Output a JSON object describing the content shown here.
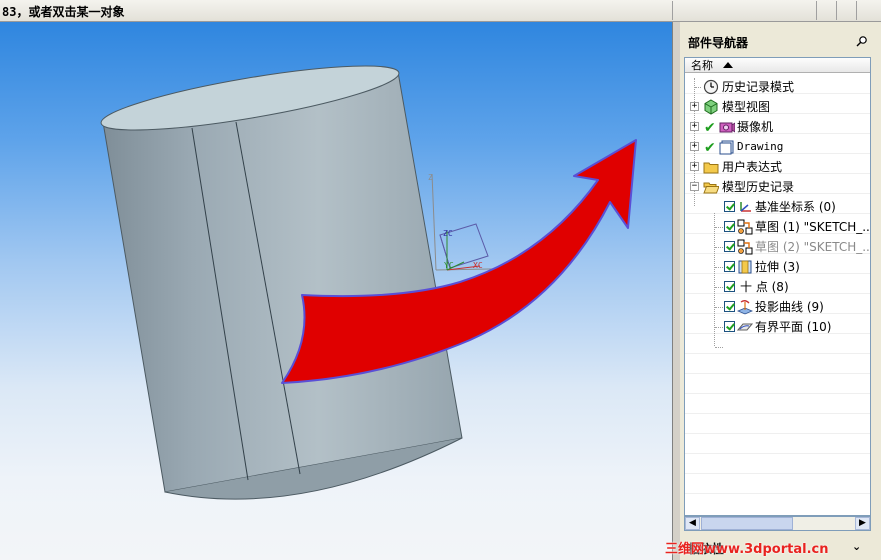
{
  "status_bar": {
    "message": "83，或者双击某一对象"
  },
  "navigator": {
    "title": "部件导航器",
    "column_header": "名称",
    "pin_icon": "pin-icon",
    "nodes": [
      {
        "label": "历史记录模式",
        "icon": "clock-icon"
      },
      {
        "label": "模型视图",
        "icon": "model-views-icon",
        "expander": "+"
      },
      {
        "label": "摄像机",
        "icon": "camera-icon",
        "expander": "+"
      },
      {
        "label": "Drawing",
        "icon": "drawing-icon",
        "expander": "+"
      },
      {
        "label": "用户表达式",
        "icon": "folder-icon",
        "expander": "+"
      },
      {
        "label": "模型历史记录",
        "icon": "folder-open-icon",
        "expander": "−"
      },
      {
        "label": "基准坐标系 (0)",
        "icon": "datum-csys-icon"
      },
      {
        "label": "草图 (1) \"SKETCH_...",
        "icon": "sketch-icon"
      },
      {
        "label": "草图 (2) \"SKETCH_...",
        "icon": "sketch-icon"
      },
      {
        "label": "拉伸 (3)",
        "icon": "extrude-icon"
      },
      {
        "label": "十 点 (8)",
        "icon": "point-icon"
      },
      {
        "label": "投影曲线 (9)",
        "icon": "projected-curve-icon"
      },
      {
        "label": "有界平面 (10)",
        "icon": "bounded-plane-icon"
      }
    ]
  },
  "sub_panel": {
    "label": "相依性"
  },
  "viewport": {
    "axis_labels": {
      "zc": "ZC",
      "yc": "YC",
      "xc": "XC",
      "z": "Z",
      "x": "X"
    },
    "arrow_color": "#e00000",
    "arrow_outline": "#5a4fd6",
    "cylinder_color": "#a4b3bc"
  },
  "watermark": "三维网www.3dportal.cn"
}
